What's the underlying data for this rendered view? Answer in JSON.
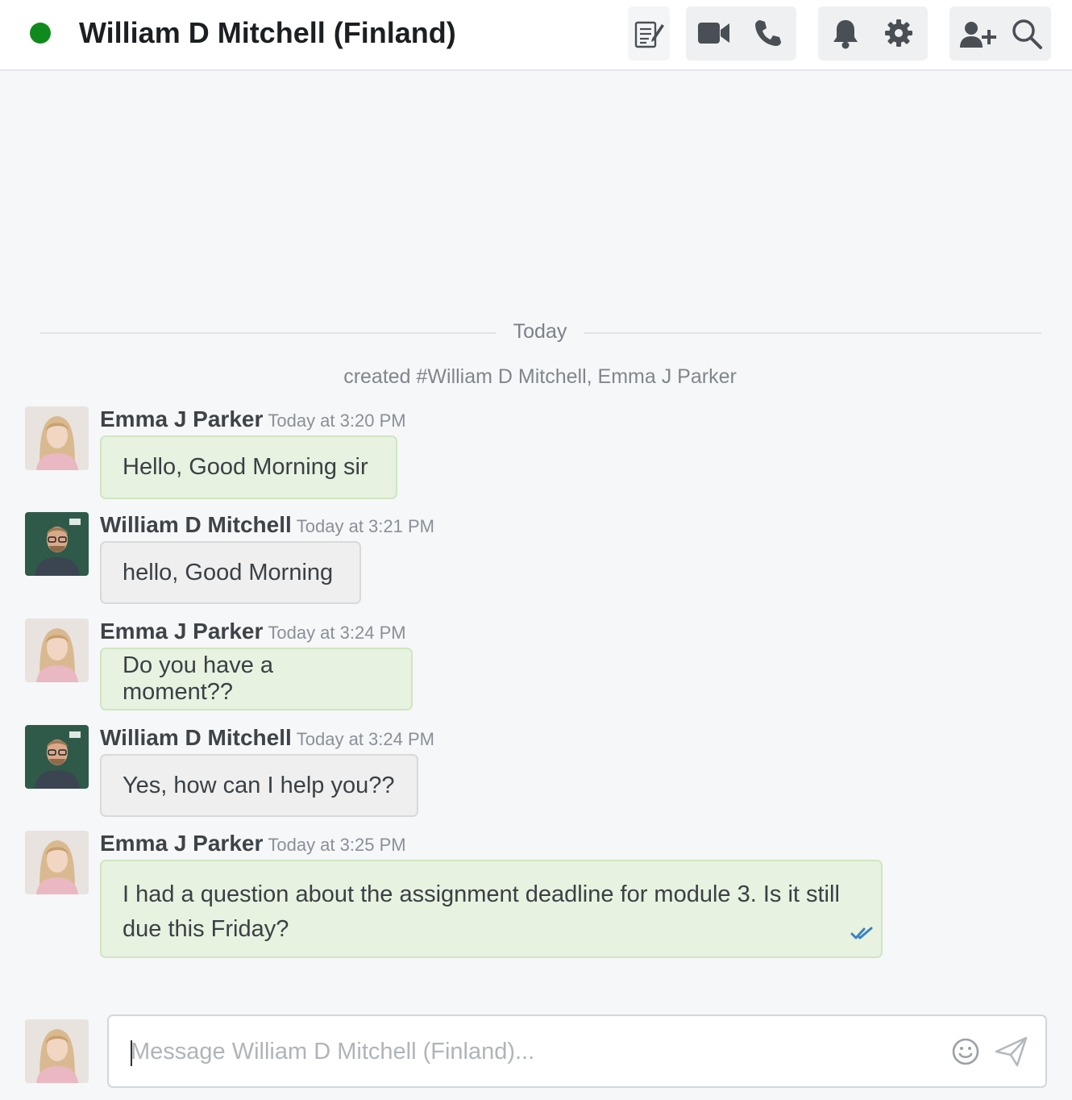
{
  "header": {
    "title": "William D Mitchell (Finland)",
    "status_color": "#0f8a1c",
    "icons": [
      "notes-icon",
      "video-icon",
      "phone-icon",
      "bell-icon",
      "gear-icon",
      "add-user-icon",
      "search-icon"
    ]
  },
  "divider": {
    "label": "Today"
  },
  "system_message": "created #William D Mitchell, Emma J Parker",
  "messages": [
    {
      "author": "Emma J Parker",
      "time": "Today at 3:20 PM",
      "text": "Hello, Good Morning sir"
    },
    {
      "author": "William D Mitchell",
      "time": "Today at 3:21 PM",
      "text": "hello, Good Morning"
    },
    {
      "author": "Emma J Parker",
      "time": "Today at 3:24 PM",
      "text": "Do you have a moment??"
    },
    {
      "author": "William D Mitchell",
      "time": "Today at 3:24 PM",
      "text": "Yes, how can I help you??"
    },
    {
      "author": "Emma J Parker",
      "time": "Today at 3:25 PM",
      "text": "I had a question about the assignment deadline for module 3. Is it still due this Friday?"
    }
  ],
  "composer": {
    "placeholder": "Message William D Mitchell (Finland)..."
  },
  "colors": {
    "own_bubble": "#e7f2e0",
    "other_bubble": "#efefef",
    "read_check": "#3b82c4"
  }
}
